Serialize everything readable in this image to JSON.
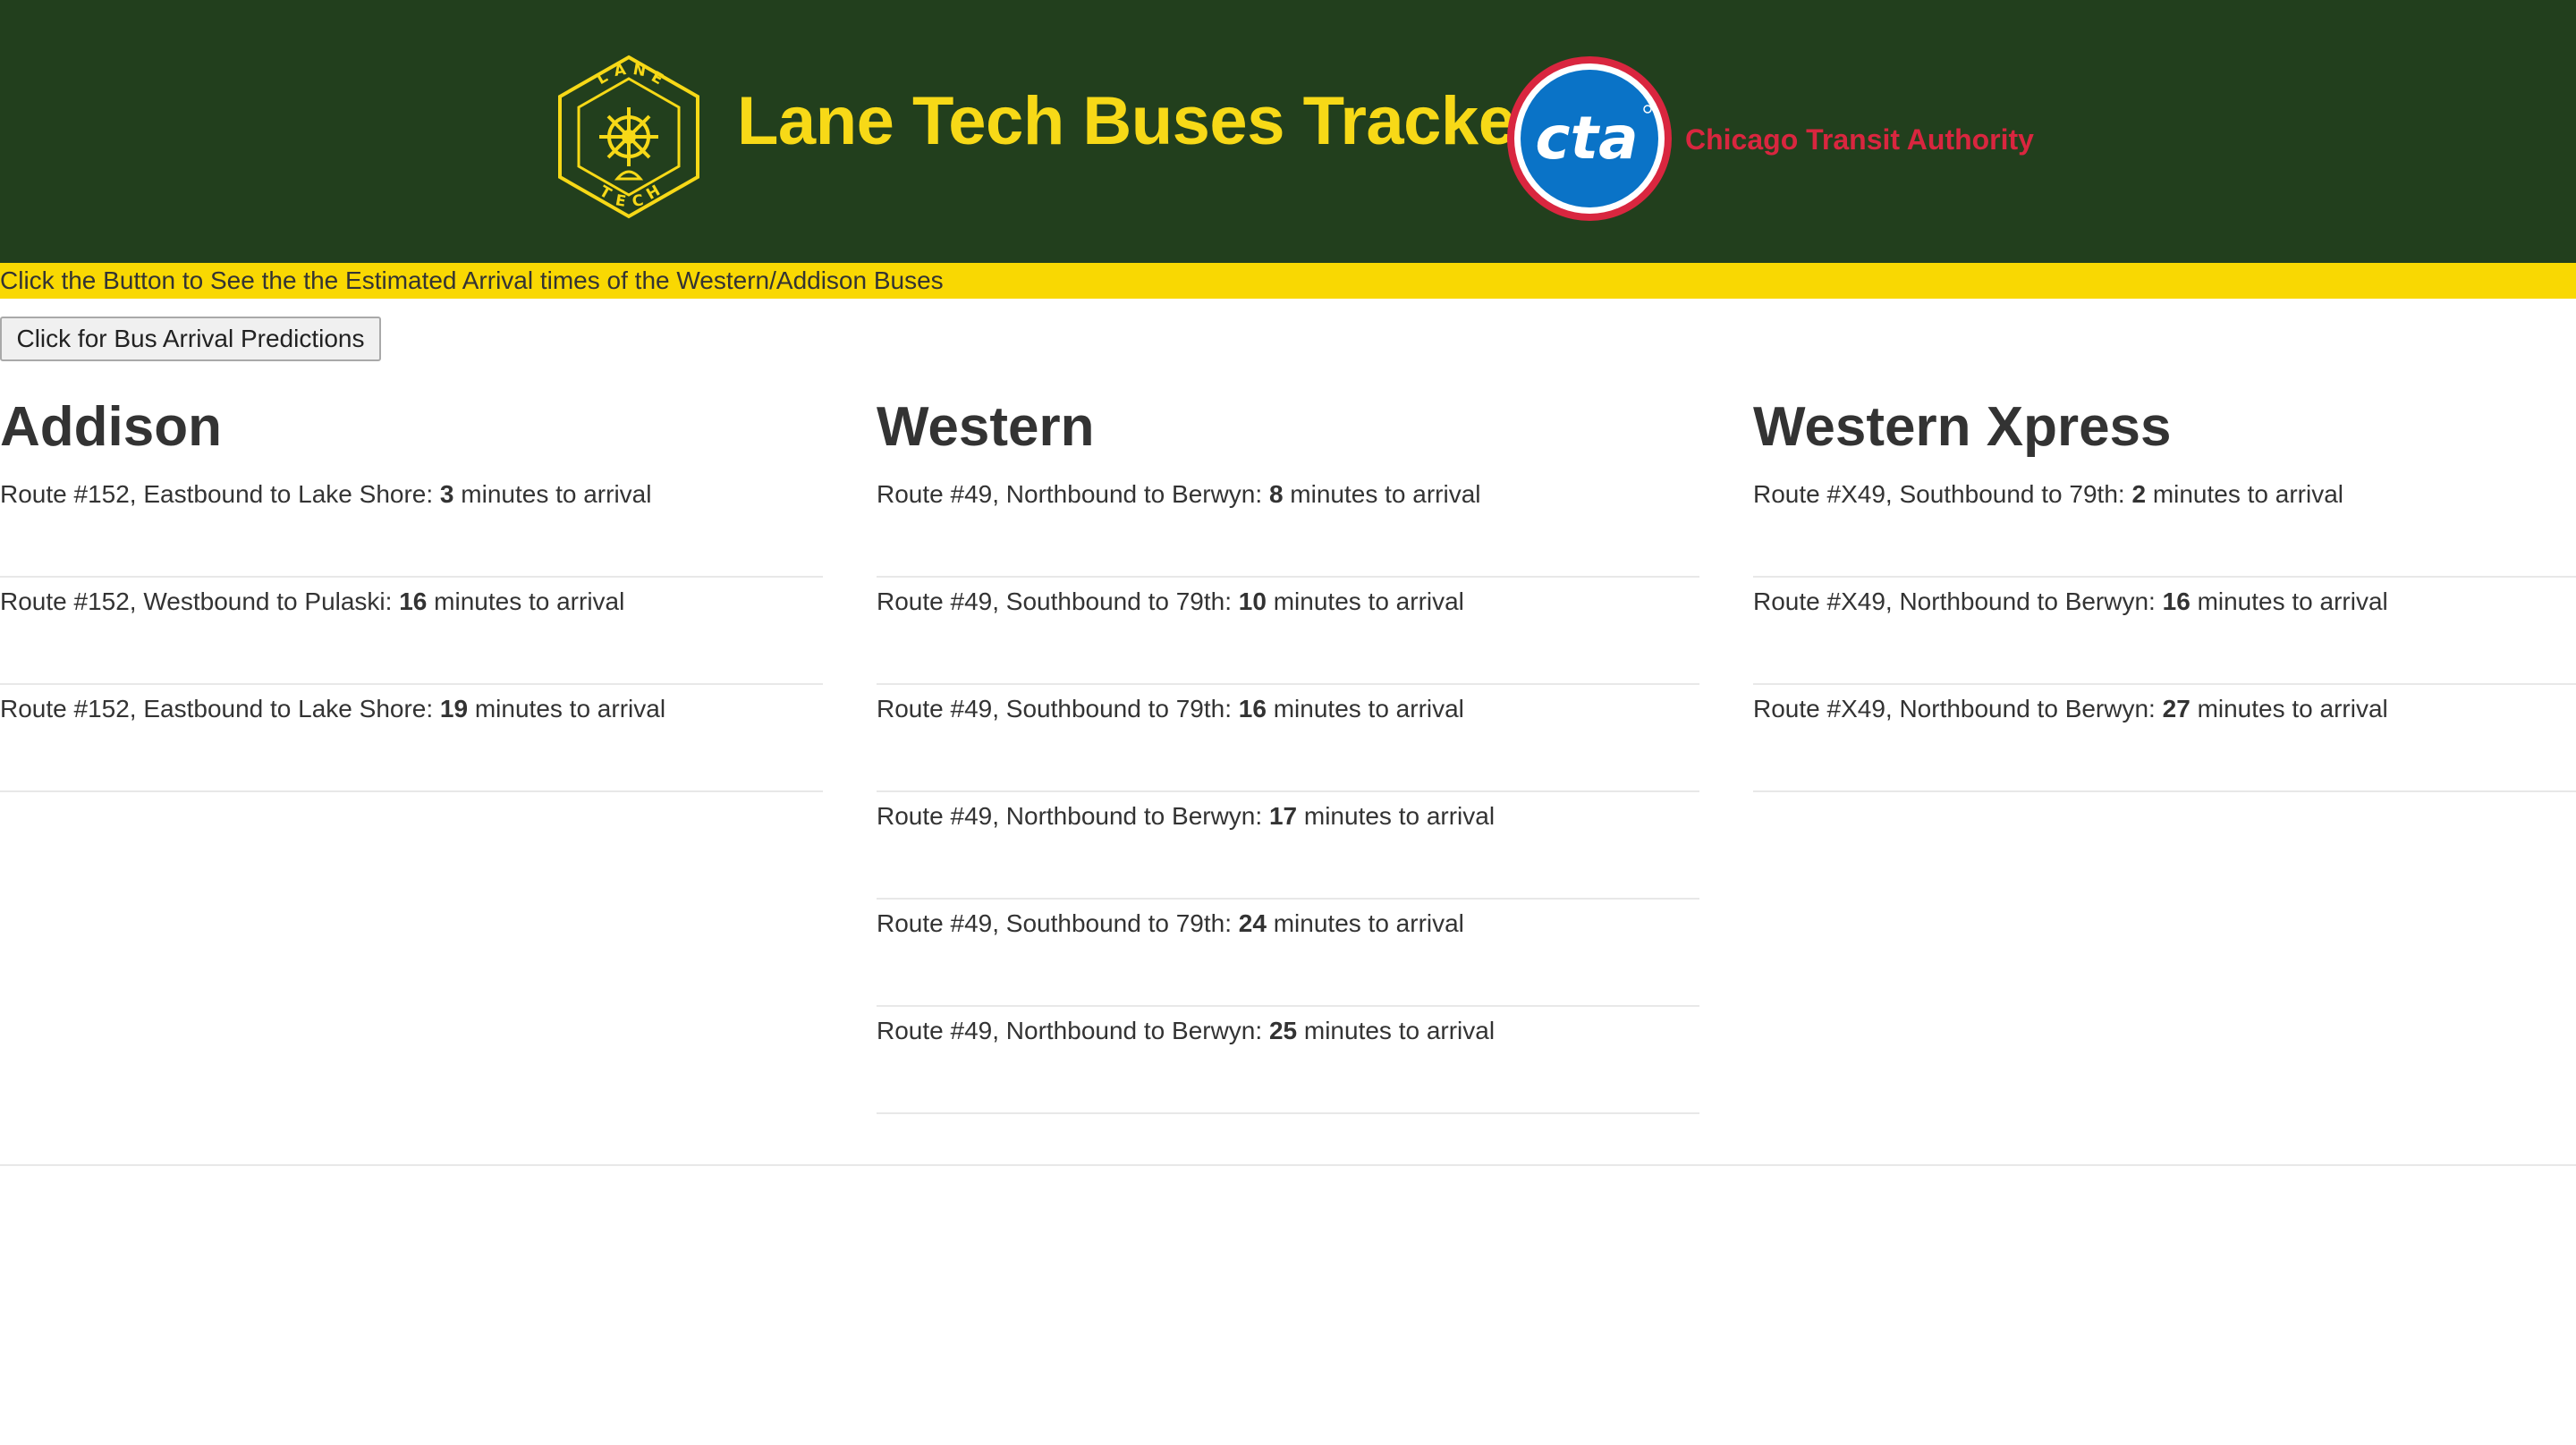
{
  "header": {
    "title": "Lane Tech Buses Tracker",
    "lane_tech_logo": {
      "icon": "lane-tech-hexagon-logo-icon",
      "letters_top": [
        "L",
        "A",
        "N",
        "E"
      ],
      "letters_bottom": [
        "T",
        "E",
        "C",
        "H"
      ]
    },
    "cta_logo": {
      "icon": "cta-circle-logo-icon",
      "text": "cta"
    },
    "cta_name": "Chicago Transit Authority"
  },
  "banner": {
    "text": "Click the Button to See the the Estimated Arrival times of the Western/Addison Buses"
  },
  "button": {
    "label": "Click for Bus Arrival Predictions"
  },
  "unit_suffix": "minutes to arrival",
  "columns": [
    {
      "title": "Addison",
      "predictions": [
        {
          "route": "Route #152, Eastbound to Lake Shore:",
          "minutes": "3",
          "suffix": "minutes to arrival"
        },
        {
          "route": "Route #152, Westbound to Pulaski:",
          "minutes": "16",
          "suffix": "minutes to arrival"
        },
        {
          "route": "Route #152, Eastbound to Lake Shore:",
          "minutes": "19",
          "suffix": "minutes to arrival"
        }
      ]
    },
    {
      "title": "Western",
      "predictions": [
        {
          "route": "Route #49, Northbound to Berwyn:",
          "minutes": "8",
          "suffix": "minutes to arrival"
        },
        {
          "route": "Route #49, Southbound to 79th:",
          "minutes": "10",
          "suffix": "minutes to arrival"
        },
        {
          "route": "Route #49, Southbound to 79th:",
          "minutes": "16",
          "suffix": "minutes to arrival"
        },
        {
          "route": "Route #49, Northbound to Berwyn:",
          "minutes": "17",
          "suffix": "minutes to arrival"
        },
        {
          "route": "Route #49, Southbound to 79th:",
          "minutes": "24",
          "suffix": "minutes to arrival"
        },
        {
          "route": "Route #49, Northbound to Berwyn:",
          "minutes": "25",
          "suffix": "minutes to arrival"
        }
      ]
    },
    {
      "title": "Western Xpress",
      "predictions": [
        {
          "route": "Route #X49, Southbound to 79th:",
          "minutes": "2",
          "suffix": "minutes to arrival"
        },
        {
          "route": "Route #X49, Northbound to Berwyn:",
          "minutes": "16",
          "suffix": "minutes to arrival"
        },
        {
          "route": "Route #X49, Northbound to Berwyn:",
          "minutes": "27",
          "suffix": "minutes to arrival"
        }
      ]
    }
  ],
  "colors": {
    "header_bg": "#223f1d",
    "title_yellow": "#f7d917",
    "banner_yellow": "#f9d802",
    "cta_blue": "#0a73c7",
    "cta_red": "#d9263f"
  }
}
